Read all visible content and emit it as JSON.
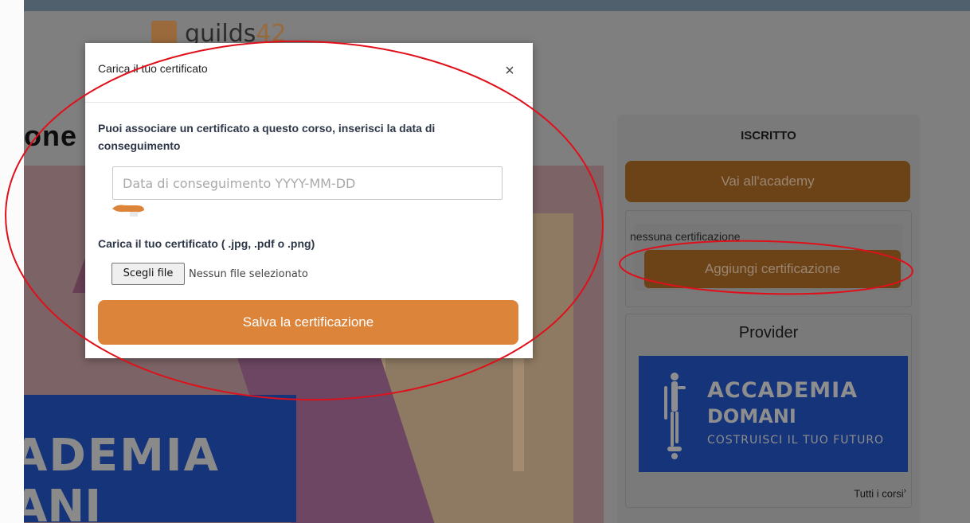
{
  "brand": {
    "logo_text": "guilds",
    "logo_number": "42"
  },
  "page": {
    "title_fragment": "one"
  },
  "hero": {
    "text_line1": "ADEMIA",
    "text_line2": "ANI"
  },
  "sidebar": {
    "status": "ISCRITTO",
    "go_academy_label": "Vai all'academy",
    "no_certification_text": "nessuna certificazione",
    "add_certification_label": "Aggiungi certificazione",
    "provider_title": "Provider",
    "provider_logo": {
      "line1": "ACCADEMIA",
      "line2": "DOMANI",
      "line3": "COSTRUISCI IL TUO FUTURO"
    },
    "all_courses_label": "Tutti i corsi",
    "all_courses_icon": "chevron-right-icon"
  },
  "modal": {
    "title": "Carica il tuo certificato",
    "close_label": "×",
    "description": "Puoi associare un certificato a questo corso, inserisci la data di conseguimento",
    "date_field": {
      "placeholder": "Data di conseguimento YYYY-MM-DD",
      "value": ""
    },
    "upload_label": "Carica il tuo certificato ( .jpg, .pdf o .png)",
    "file_button_label": "Scegli file",
    "file_status": "Nessun file selezionato",
    "save_label": "Salva la certificazione"
  },
  "colors": {
    "accent_orange": "#dc843a",
    "annotation_red": "#e0101a",
    "overlay_dim": "#7f7f7f",
    "provider_blue": "#16347a"
  }
}
